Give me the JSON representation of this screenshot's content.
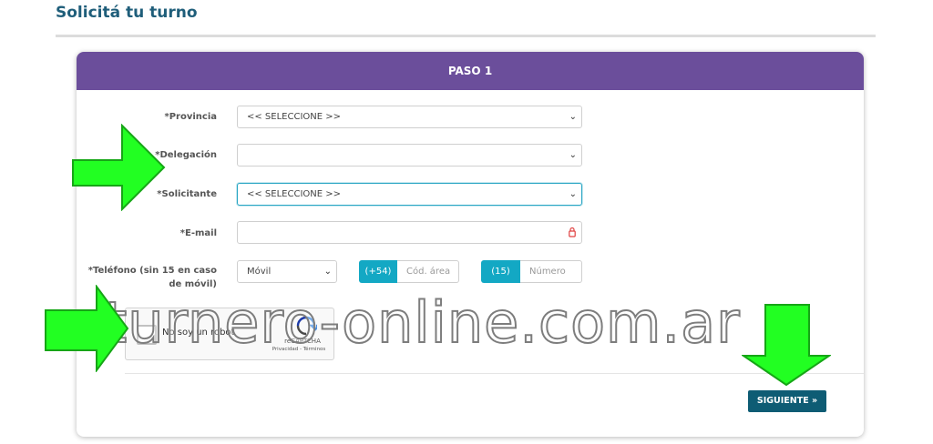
{
  "page": {
    "title": "Solicitá tu turno"
  },
  "card": {
    "header": "PASO 1"
  },
  "form": {
    "provincia": {
      "label": "*Provincia",
      "value": "<< SELECCIONE >>"
    },
    "delegacion": {
      "label": "*Delegación",
      "value": ""
    },
    "solicitante": {
      "label": "*Solicitante",
      "value": "<< SELECCIONE >>"
    },
    "email": {
      "label": "*E-mail",
      "value": ""
    },
    "telefono": {
      "label": "*Teléfono (sin 15 en caso de móvil)",
      "type_value": "Móvil",
      "country_code": "(+54)",
      "area_placeholder": "Cód. área",
      "prefix": "(15)",
      "number_placeholder": "Número"
    }
  },
  "captcha": {
    "label": "No soy un robot",
    "brand": "reCAPTCHA",
    "links": "Privacidad - Términos"
  },
  "actions": {
    "next_label": "SIGUIENTE »"
  },
  "watermark": {
    "text": "turnero-online.com.ar"
  },
  "colors": {
    "header": "#6b4e9b",
    "accent": "#13a8c4",
    "button": "#0e5c74",
    "arrow": "#22ff22",
    "title": "#1f5e7a"
  }
}
